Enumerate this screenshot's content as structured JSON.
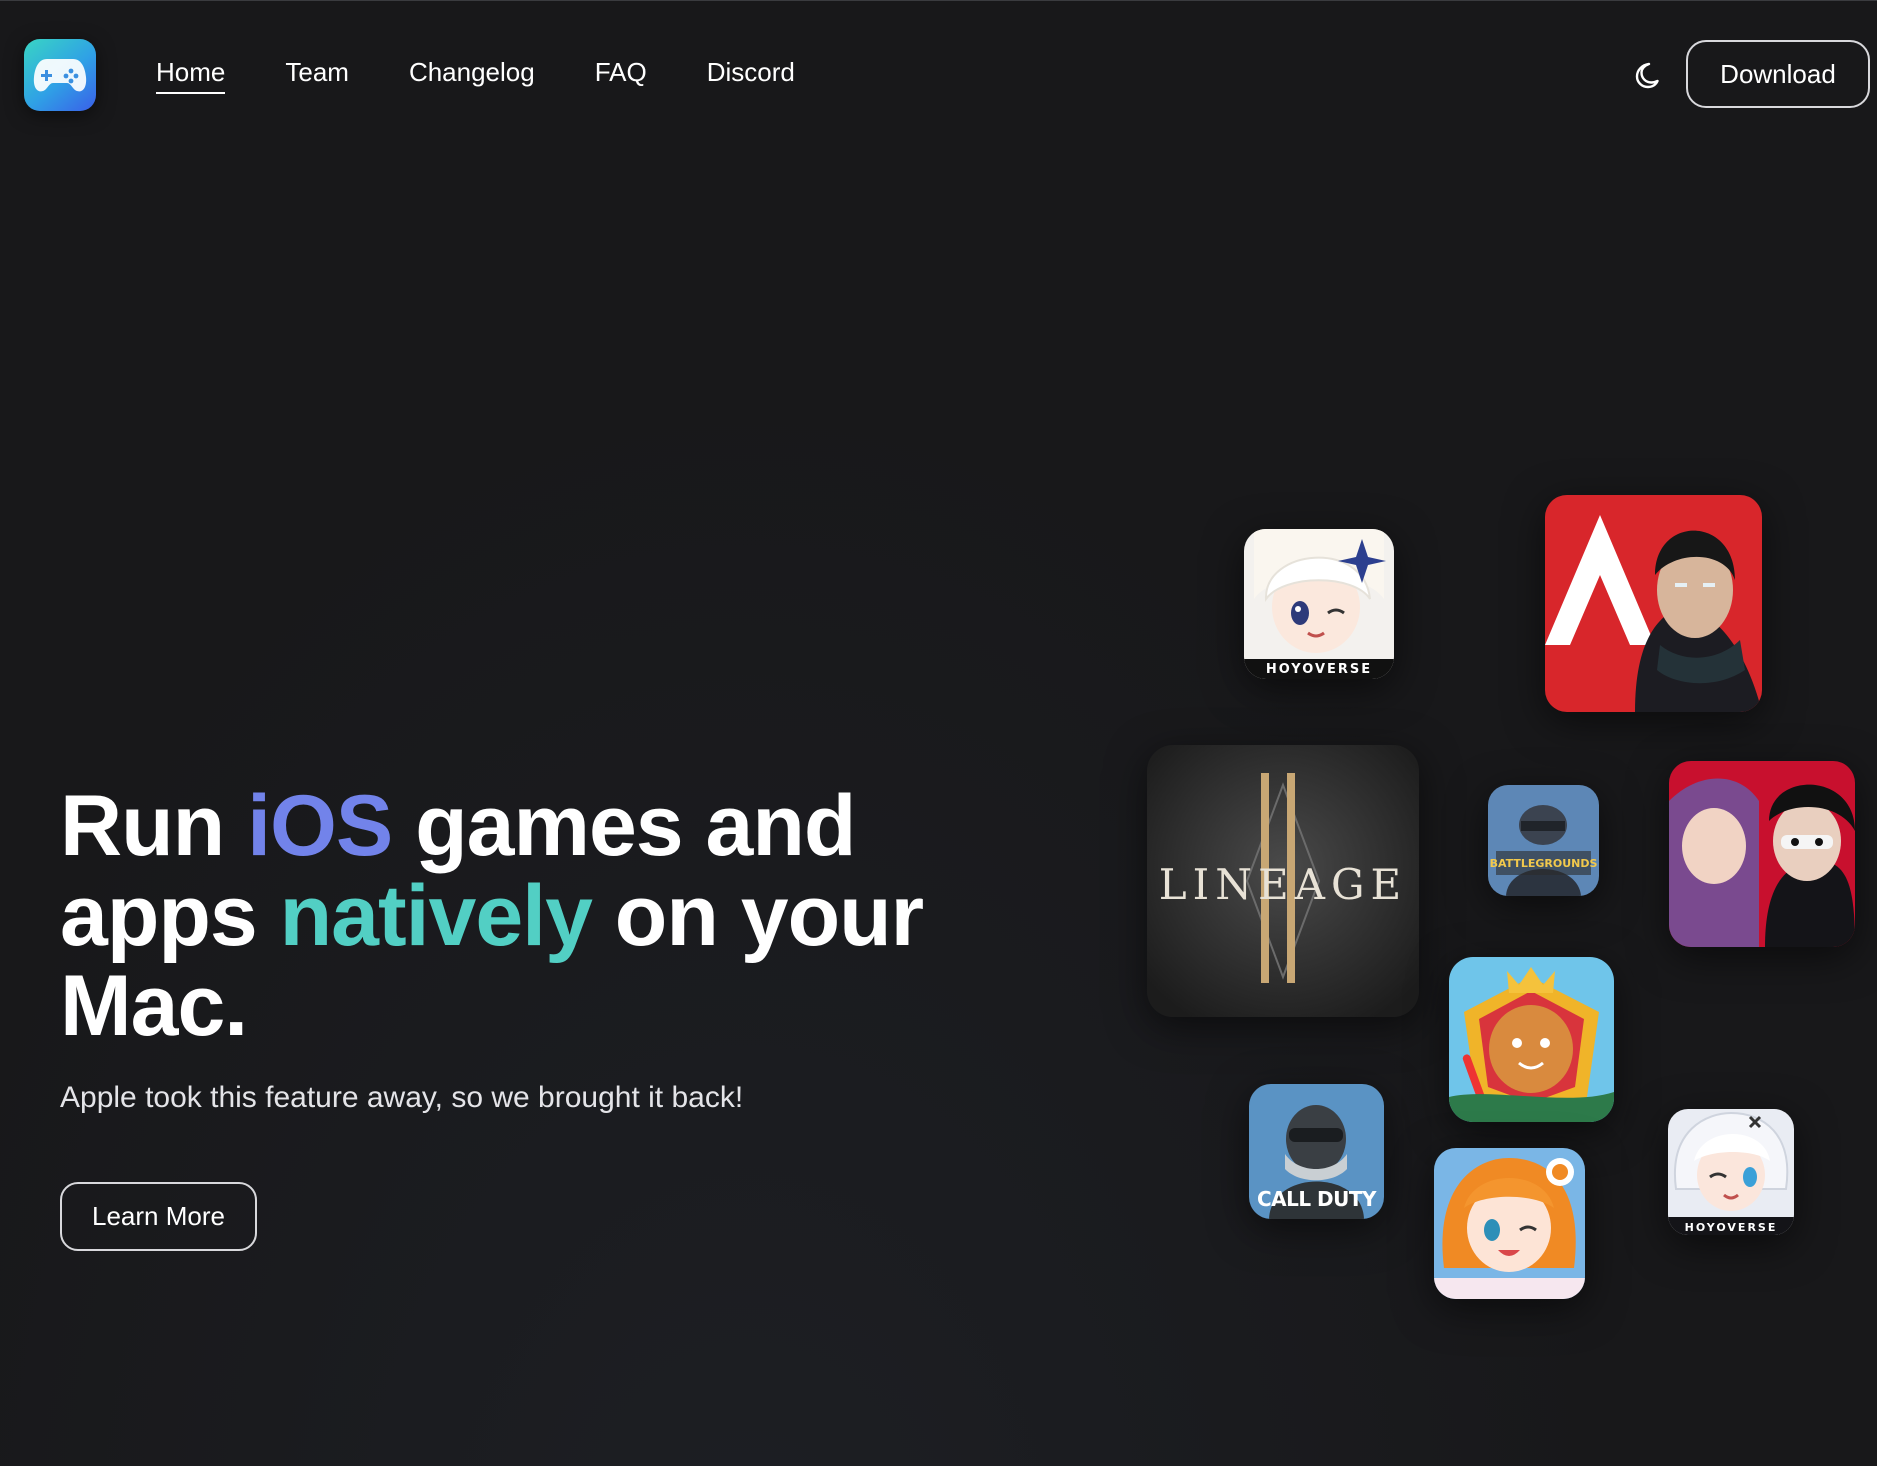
{
  "nav": {
    "items": [
      {
        "label": "Home",
        "active": true
      },
      {
        "label": "Team",
        "active": false
      },
      {
        "label": "Changelog",
        "active": false
      },
      {
        "label": "FAQ",
        "active": false
      },
      {
        "label": "Discord",
        "active": false
      }
    ],
    "download_label": "Download",
    "logo_icon": "gamepad-icon",
    "theme_icon": "moon-icon"
  },
  "hero": {
    "title_part1": "Run ",
    "title_accent1": "iOS",
    "title_part2": " games and apps ",
    "title_accent2": "natively",
    "title_part3": " on your Mac.",
    "subtitle": "Apple took this feature away, so we brought it back!",
    "learn_more_label": "Learn More"
  },
  "colors": {
    "background": "#18181a",
    "accent_ios": "#7283ea",
    "accent_native": "#52cfc4"
  },
  "apps": {
    "genshin_caption": "HOYOVERSE",
    "lineage_caption": "LINEAGE",
    "pubg_caption": "BATTLEGROUNDS",
    "cod_caption": "CALL DUTY",
    "honkai_caption": "HOYOVERSE"
  }
}
